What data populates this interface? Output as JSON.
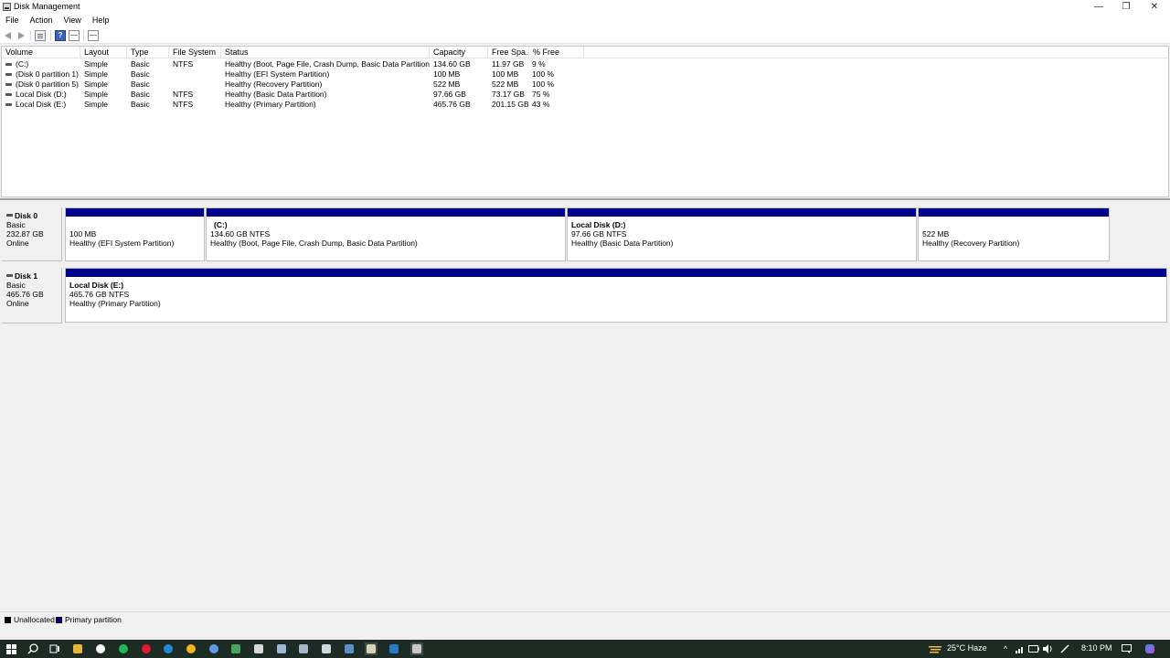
{
  "window": {
    "title": "Disk Management",
    "controls": {
      "minimize": "—",
      "restore": "❐",
      "close": "✕"
    }
  },
  "menu": [
    {
      "label": "File"
    },
    {
      "label": "Action"
    },
    {
      "label": "View"
    },
    {
      "label": "Help"
    }
  ],
  "toolbar": {
    "icons": [
      "back-arrow-icon",
      "forward-arrow-icon",
      "properties-icon",
      "help-icon",
      "details-view-icon",
      "console-icon"
    ],
    "help_glyph": "?"
  },
  "volume_table": {
    "columns": [
      "Volume",
      "Layout",
      "Type",
      "File System",
      "Status",
      "Capacity",
      "Free Spa...",
      "% Free"
    ],
    "rows": [
      [
        "(C:)",
        "Simple",
        "Basic",
        "NTFS",
        "Healthy (Boot, Page File, Crash Dump, Basic Data Partition)",
        "134.60 GB",
        "11.97 GB",
        "9 %"
      ],
      [
        "(Disk 0 partition 1)",
        "Simple",
        "Basic",
        "",
        "Healthy (EFI System Partition)",
        "100 MB",
        "100 MB",
        "100 %"
      ],
      [
        "(Disk 0 partition 5)",
        "Simple",
        "Basic",
        "",
        "Healthy (Recovery Partition)",
        "522 MB",
        "522 MB",
        "100 %"
      ],
      [
        "Local Disk (D:)",
        "Simple",
        "Basic",
        "NTFS",
        "Healthy (Basic Data Partition)",
        "97.66 GB",
        "73.17 GB",
        "75 %"
      ],
      [
        "Local Disk (E:)",
        "Simple",
        "Basic",
        "NTFS",
        "Healthy (Primary Partition)",
        "465.76 GB",
        "201.15 GB",
        "43 %"
      ]
    ]
  },
  "disks": [
    {
      "name": "Disk 0",
      "type": "Basic",
      "size": "232.87 GB",
      "status": "Online",
      "partitions": [
        {
          "name": "",
          "size": "100 MB",
          "status": "Healthy (EFI System Partition)"
        },
        {
          "name": "(C:)",
          "size": "134.60 GB NTFS",
          "status": "Healthy (Boot, Page File, Crash Dump, Basic Data Partition)"
        },
        {
          "name": "Local Disk  (D:)",
          "size": "97.66 GB NTFS",
          "status": "Healthy (Basic Data Partition)"
        },
        {
          "name": "",
          "size": "522 MB",
          "status": "Healthy (Recovery Partition)"
        }
      ]
    },
    {
      "name": "Disk 1",
      "type": "Basic",
      "size": "465.76 GB",
      "status": "Online",
      "partitions": [
        {
          "name": "Local Disk  (E:)",
          "size": "465.76 GB NTFS",
          "status": "Healthy (Primary Partition)"
        }
      ]
    }
  ],
  "legend": {
    "unallocated": {
      "label": "Unallocated",
      "color": "#000000"
    },
    "primary": {
      "label": "Primary partition",
      "color": "#00008a"
    }
  },
  "taskbar": {
    "apps": [
      "start-icon",
      "search-icon",
      "task-view-icon",
      "file-explorer-icon",
      "media-player-icon",
      "spotify-icon",
      "opera-icon",
      "edge-icon",
      "chrome-icon",
      "browser-icon",
      "app-icon",
      "notepad-icon",
      "photos-icon",
      "tool-icon",
      "folder-icon",
      "keyboard-icon",
      "disk-management-icon",
      "window-icon",
      "disk-tool-icon"
    ],
    "weather": "25°C  Haze",
    "clock": "8:10 PM"
  }
}
